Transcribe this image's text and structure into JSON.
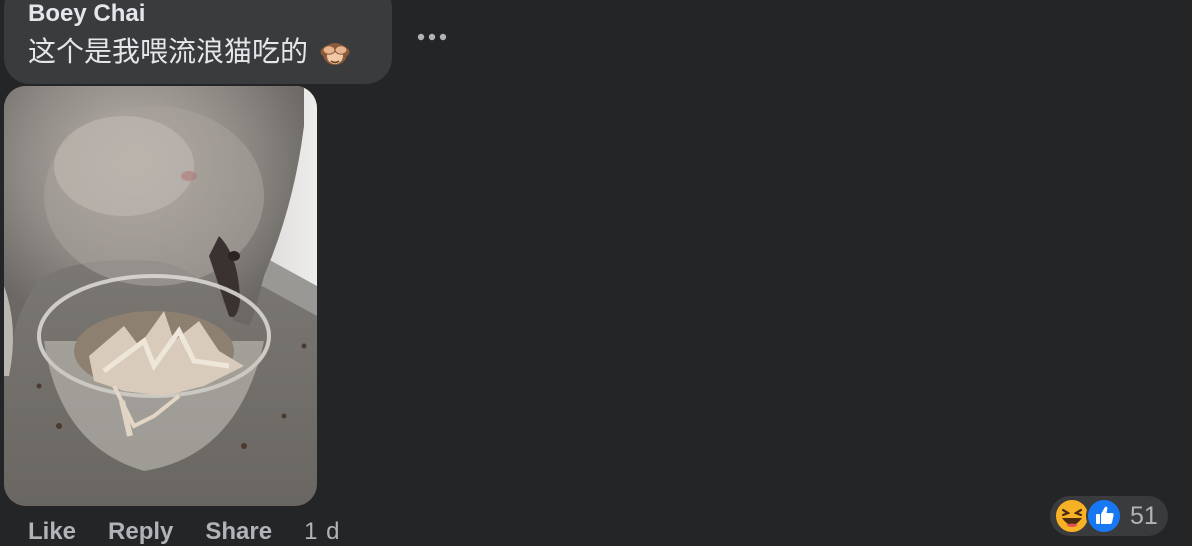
{
  "comment": {
    "author": "Boey Chai",
    "text": "这个是我喂流浪猫吃的",
    "emoji": "see-no-evil-monkey-icon"
  },
  "actions": {
    "like_label": "Like",
    "reply_label": "Reply",
    "share_label": "Share",
    "timestamp": "1 d"
  },
  "reactions": {
    "types": [
      "haha-reaction-icon",
      "like-reaction-icon"
    ],
    "count": "51"
  },
  "colors": {
    "background": "#242526",
    "bubble": "#3a3b3c",
    "primary_text": "#e4e6eb",
    "secondary_text": "#b0b3b8",
    "like_blue": "#1877f2",
    "haha_yellow": "#f7b125"
  }
}
